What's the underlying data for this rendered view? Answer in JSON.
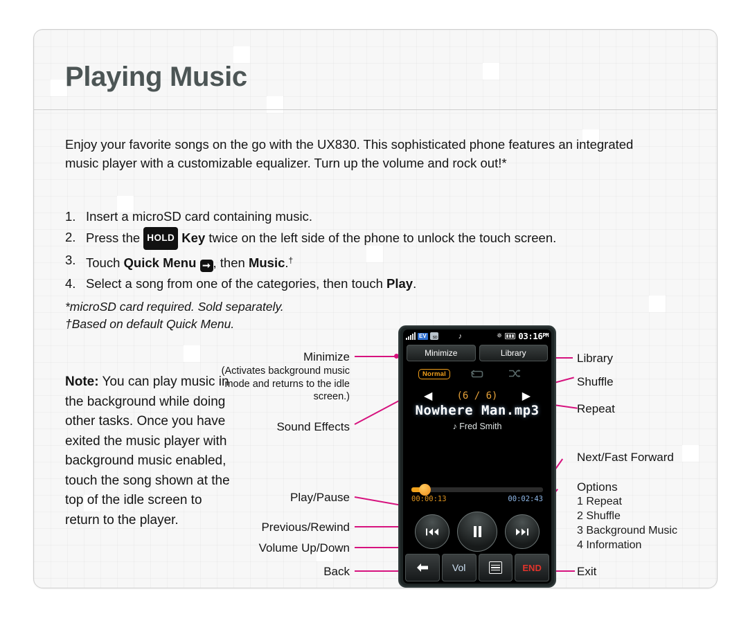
{
  "page": {
    "title": "Playing Music",
    "intro": "Enjoy your favorite songs on the go with the UX830. This sophisticated phone features an integrated music player with a customizable equalizer. Turn up the volume and rock out!*",
    "steps": [
      {
        "num": "1.",
        "pre": "Insert a microSD card containing music.",
        "badge": "",
        "mid": "",
        "post": ""
      },
      {
        "num": "2.",
        "pre": "Press the ",
        "badge": "HOLD",
        "mid": " Key",
        "post": " twice on the left side of the phone to unlock the touch screen."
      },
      {
        "num": "3.",
        "pre": "Touch ",
        "badge": "Quick Menu",
        "mid": " ➔",
        "post": ", then Music."
      },
      {
        "num": "4.",
        "pre": "Select a song from one of the categories, then touch ",
        "badge": "Play",
        "mid": "",
        "post": "."
      }
    ],
    "footnotes": [
      "*microSD card required. Sold separately.",
      "†Based on default Quick Menu."
    ],
    "note_label": "Note:",
    "note_body": " You can play music in the background while doing other tasks. Once you have exited the music player with background music enabled, touch the song shown at the top of the idle screen to return to the player."
  },
  "callouts": {
    "minimize": "Minimize",
    "minimize_sub": "(Activates background music mode and returns to the idle screen.)",
    "sound_effects": "Sound Effects",
    "play_pause": "Play/Pause",
    "previous_rewind": "Previous/Rewind",
    "volume_up_down": "Volume Up/Down",
    "back": "Back",
    "library": "Library",
    "shuffle": "Shuffle",
    "repeat": "Repeat",
    "next_fast_forward": "Next/Fast Forward",
    "options_title": "Options",
    "options_items": [
      "1 Repeat",
      "2 Shuffle",
      "3 Background Music",
      "4 Information"
    ],
    "exit": "Exit"
  },
  "phone": {
    "statusbar": {
      "signal_icon": "signal-bars-icon",
      "ev_badge": "EV",
      "sd_icon": "SD",
      "music_note_icon": "♪",
      "gps_icon": "✵",
      "battery_icon": "battery-icon",
      "time": "03:16",
      "meridiem": "PM"
    },
    "top_buttons": {
      "minimize": "Minimize",
      "library": "Library"
    },
    "sound_effect_mode": "Normal",
    "repeat_icon": "↺",
    "shuffle_icon": "⤨",
    "prev_arrow": "◀",
    "next_arrow": "▶",
    "track_index": "(6 / 6)",
    "track_name": "Nowhere Man.mp3",
    "artist_note": "♪",
    "artist": "Fred Smith",
    "elapsed": "00:00:13",
    "duration": "00:02:43",
    "controls": {
      "previous": "⏮",
      "play_pause": "⏸",
      "next": "⏭"
    },
    "bottom_bar": {
      "back": "←",
      "vol": "Vol",
      "menu": "menu-icon",
      "end": "END"
    }
  },
  "colors": {
    "accent_magenta": "#d6127e",
    "title_gray": "#4c5555",
    "amber": "#f0a21c",
    "end_red": "#e2342c",
    "card_bg": "#f7f7f7"
  }
}
